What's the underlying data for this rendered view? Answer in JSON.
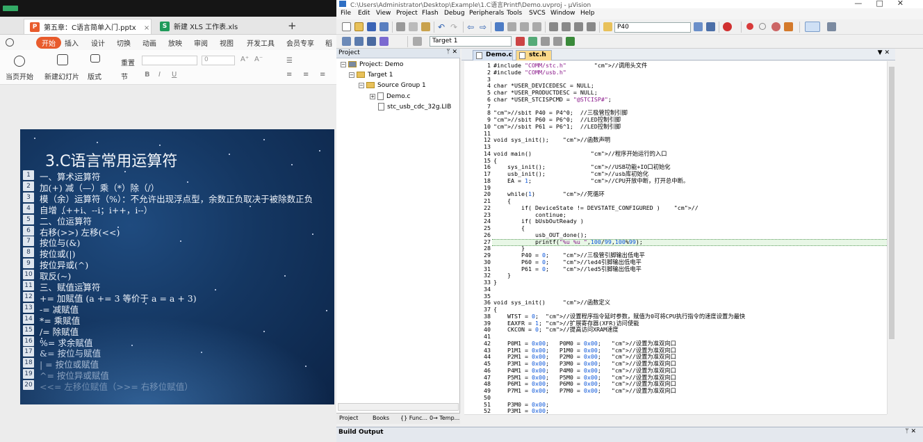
{
  "wps": {
    "tabs": [
      {
        "label": "第五章：C语言简单入门.pptx",
        "icon": "P",
        "color": "#e85b2c",
        "active": true
      },
      {
        "label": "新建 XLS 工作表.xls",
        "icon": "S",
        "color": "#1f9a5a",
        "active": false
      }
    ],
    "new_tab": "+",
    "menu": [
      "开始",
      "插入",
      "设计",
      "切换",
      "动画",
      "放映",
      "审阅",
      "视图",
      "开发工具",
      "会员专享",
      "稻壳"
    ],
    "ribbon": {
      "play_label": "当页开始",
      "new_slide_label": "新建幻灯片",
      "layout_label": "版式",
      "section_label": "节",
      "reset_label": "重置",
      "font_size": "0"
    },
    "slide": {
      "title": "3.C语言常用运算符",
      "lines": [
        "一、算术运算符",
        "加(+) 减（—）乘（*）除（/）",
        "模（余）运算符（%）：不允许出现浮点型，余数正负取决于被除数正负",
        "自增（++i、--i；i++，i--）",
        "二、位运算符",
        "右移(>>) 左移(<<)",
        "按位与(&)",
        "按位或(|)",
        "按位异或(^)",
        "取反(~)",
        "三、赋值运算符",
        "+= 加赋值 (a += 3 等价于 a = a + 3)",
        "-= 减赋值",
        "*= 乘赋值",
        "/= 除赋值",
        "%= 求余赋值",
        "&= 按位与赋值",
        "| = 按位或赋值",
        "^= 按位异或赋值",
        "<<= 左移位赋值（>>= 右移位赋值）"
      ]
    }
  },
  "ide": {
    "title": "C:\\Users\\Administrator\\Desktop\\Example\\1.C语言Printf\\Demo.uvproj - µVision",
    "menu": [
      "File",
      "Edit",
      "View",
      "Project",
      "Flash",
      "Debug",
      "Peripherals",
      "Tools",
      "SVCS",
      "Window",
      "Help"
    ],
    "toolbar_combo": "P40",
    "target_combo": "Target 1",
    "project_panel": {
      "header": "Project",
      "nodes": [
        "Project: Demo",
        "Target 1",
        "Source Group 1",
        "Demo.c",
        "stc_usb_cdc_32g.LIB"
      ],
      "tabs": [
        "Project",
        "Books",
        "{} Func...",
        "0→ Temp..."
      ]
    },
    "editor_tabs": [
      "Demo.c",
      "stc.h"
    ],
    "code_lines": [
      {
        "n": "1",
        "t": "#include \"COMM/stc.h\"        //调用头文件"
      },
      {
        "n": "2",
        "t": "#include \"COMM/usb.h\""
      },
      {
        "n": "3",
        "t": ""
      },
      {
        "n": "4",
        "t": "char *USER_DEVICEDESC = NULL;"
      },
      {
        "n": "5",
        "t": "char *USER_PRODUCTDESC = NULL;"
      },
      {
        "n": "6",
        "t": "char *USER_STCISPCMD = \"@STCISP#\";"
      },
      {
        "n": "7",
        "t": ""
      },
      {
        "n": "8",
        "t": "//sbit P40 = P4^0;  //三极管控制引脚"
      },
      {
        "n": "9",
        "t": "//sbit P60 = P6^0;  //LED控制引脚"
      },
      {
        "n": "10",
        "t": "//sbit P61 = P6^1;  //LED控制引脚"
      },
      {
        "n": "11",
        "t": ""
      },
      {
        "n": "12",
        "t": "void sys_init();    //函数声明"
      },
      {
        "n": "13",
        "t": ""
      },
      {
        "n": "14",
        "t": "void main()                 //程序开始运行的入口"
      },
      {
        "n": "15",
        "t": "{"
      },
      {
        "n": "16",
        "t": "    sys_init();             //USB功能+IO口初始化"
      },
      {
        "n": "17",
        "t": "    usb_init();             //usb库初始化"
      },
      {
        "n": "18",
        "t": "    EA = 1;                 //CPU开放中断，打开总中断。"
      },
      {
        "n": "19",
        "t": ""
      },
      {
        "n": "20",
        "t": "    while(1)        //死循环"
      },
      {
        "n": "21",
        "t": "    {"
      },
      {
        "n": "22",
        "t": "        if( DeviceState != DEVSTATE_CONFIGURED )    //"
      },
      {
        "n": "23",
        "t": "            continue;"
      },
      {
        "n": "24",
        "t": "        if( bUsbOutReady )"
      },
      {
        "n": "25",
        "t": "        {"
      },
      {
        "n": "26",
        "t": "            usb_OUT_done();"
      },
      {
        "n": "27",
        "t": "            printf(\"%u %u \",100/99,100%99);"
      },
      {
        "n": "28",
        "t": "        }"
      },
      {
        "n": "29",
        "t": "        P40 = 0;    //三极管引脚输出低电平"
      },
      {
        "n": "30",
        "t": "        P60 = 0;    //led4引脚输出低电平"
      },
      {
        "n": "31",
        "t": "        P61 = 0;    //led5引脚输出低电平"
      },
      {
        "n": "32",
        "t": "    }"
      },
      {
        "n": "33",
        "t": "}"
      },
      {
        "n": "34",
        "t": ""
      },
      {
        "n": "35",
        "t": ""
      },
      {
        "n": "36",
        "t": "void sys_init()     //函数定义"
      },
      {
        "n": "37",
        "t": "{"
      },
      {
        "n": "38",
        "t": "    WTST = 0;  //设置程序指令延时参数，赋值为0可将CPU执行指令的速度设置为最快"
      },
      {
        "n": "39",
        "t": "    EAXFR = 1; //扩展寄存器(XFR)访问使能"
      },
      {
        "n": "40",
        "t": "    CKCON = 0; //提高访问XRAM速度"
      },
      {
        "n": "41",
        "t": ""
      },
      {
        "n": "42",
        "t": "    P0M1 = 0x00;   P0M0 = 0x00;   //设置为准双向口"
      },
      {
        "n": "43",
        "t": "    P1M1 = 0x00;   P1M0 = 0x00;   //设置为准双向口"
      },
      {
        "n": "44",
        "t": "    P2M1 = 0x00;   P2M0 = 0x00;   //设置为准双向口"
      },
      {
        "n": "45",
        "t": "    P3M1 = 0x00;   P3M0 = 0x00;   //设置为准双向口"
      },
      {
        "n": "46",
        "t": "    P4M1 = 0x00;   P4M0 = 0x00;   //设置为准双向口"
      },
      {
        "n": "47",
        "t": "    P5M1 = 0x00;   P5M0 = 0x00;   //设置为准双向口"
      },
      {
        "n": "48",
        "t": "    P6M1 = 0x00;   P6M0 = 0x00;   //设置为准双向口"
      },
      {
        "n": "49",
        "t": "    P7M1 = 0x00;   P7M0 = 0x00;   //设置为准双向口"
      },
      {
        "n": "50",
        "t": ""
      },
      {
        "n": "51",
        "t": "    P3M0 = 0x00;"
      },
      {
        "n": "52",
        "t": "    P3M1 = 0x00;"
      }
    ],
    "current_line": "27",
    "build_output": "Build Output"
  }
}
